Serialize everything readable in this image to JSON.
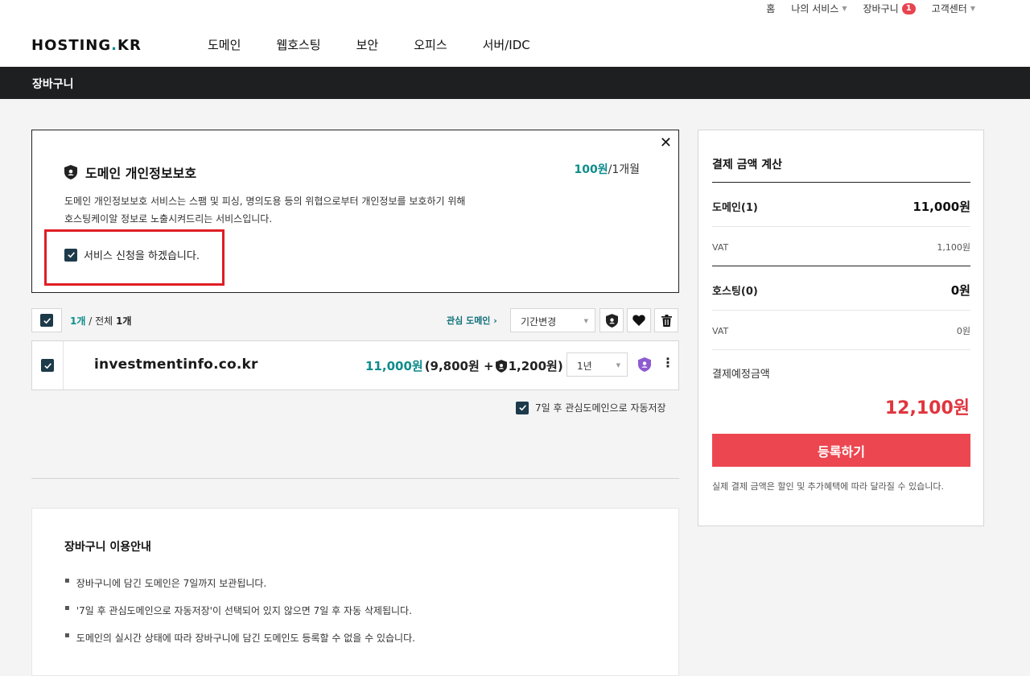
{
  "header": {
    "util_links": [
      {
        "label": "홈",
        "caret": false
      },
      {
        "label": "나의 서비스",
        "caret": true
      },
      {
        "label": "장바구니",
        "caret": false,
        "badge": "1"
      },
      {
        "label": "고객센터",
        "caret": true
      }
    ],
    "logo": {
      "left": "HOSTING",
      "dot": ".",
      "right": "KR"
    },
    "nav": [
      "도메인",
      "웹호스팅",
      "보안",
      "오피스",
      "서버/IDC"
    ]
  },
  "subbar": {
    "title": "장바구니"
  },
  "privacy": {
    "title": "도메인 개인정보보호",
    "price_value": "100원",
    "price_unit": "/1개월",
    "desc_line1": "도메인 개인정보보호 서비스는 스팸 및 피싱, 명의도용 등의 위협으로부터 개인정보를 보호하기 위해",
    "desc_line2": "호스팅케이알 정보로 노출시켜드리는 서비스입니다.",
    "agree_label": "서비스 신청을 하겠습니다.",
    "agree_checked": true,
    "close_icon": "close-icon"
  },
  "toolbar": {
    "selected": "1개",
    "separator": " / 전체 ",
    "total": "1개",
    "interest_link": "관심 도메인",
    "interest_arrow": "›",
    "period_select": "기간변경"
  },
  "domain_row": {
    "name": "investmentinfo.co.kr",
    "price_main": "11,000원",
    "price_detail_a": "(9,800원 + ",
    "price_detail_b": "1,200원)",
    "period": "1년"
  },
  "autosave_label": "7일 후 관심도메인으로 자동저장",
  "guide": {
    "title": "장바구니 이용안내",
    "items": [
      "장바구니에 담긴 도메인은 7일까지 보관됩니다.",
      "'7일 후 관심도메인으로 자동저장'이 선택되어 있지 않으면 7일 후 자동 삭제됩니다.",
      "도메인의 실시간 상태에 따라 장바구니에 담긴 도메인도 등록할 수 없을 수 있습니다."
    ]
  },
  "summary": {
    "title": "결제 금액 계산",
    "domain_label": "도메인(1)",
    "domain_value": "11,000원",
    "domain_vat_label": "VAT",
    "domain_vat_value": "1,100원",
    "hosting_label": "호스팅(0)",
    "hosting_value": "0원",
    "hosting_vat_label": "VAT",
    "hosting_vat_value": "0원",
    "total_label": "결제예정금액",
    "total_value": "12,100원",
    "register_button": "등록하기",
    "note": "실제 결제 금액은 할인 및 추가혜택에 따라 달라질 수 있습니다."
  },
  "colors": {
    "accent_teal": "#0f8c8c",
    "register_red": "#ec4650",
    "total_red": "#e0353e",
    "highlight_box": "#e01e25",
    "checkbox": "#1d3a4a"
  }
}
